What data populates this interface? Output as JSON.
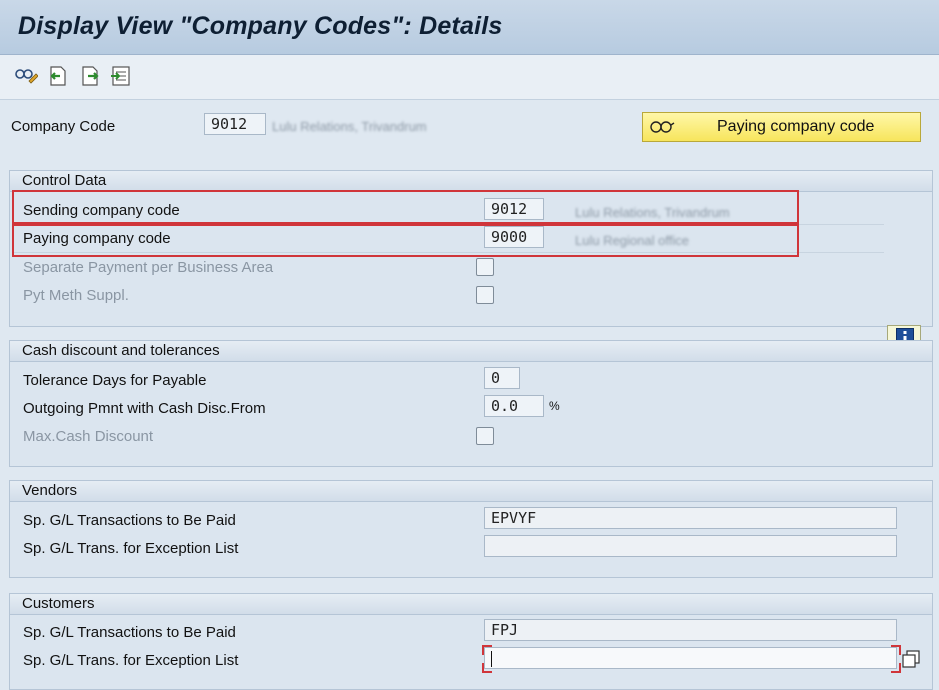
{
  "window": {
    "title": "Display View \"Company Codes\": Details"
  },
  "toolbar": {
    "icons": [
      "glasses-edit-icon",
      "previous-entry-icon",
      "next-entry-icon",
      "select-block-icon"
    ]
  },
  "company": {
    "label": "Company Code",
    "value": "9012",
    "name_text": "Lulu Relations, Trivandrum"
  },
  "paying_button": {
    "label": "Paying company code"
  },
  "control_data": {
    "title": "Control Data",
    "sending": {
      "label": "Sending company code",
      "value": "9012",
      "name_text": "Lulu Relations, Trivandrum"
    },
    "paying": {
      "label": "Paying company code",
      "value": "9000",
      "name_text": "Lulu Regional office"
    },
    "separate_payment": {
      "label": "Separate Payment per Business Area",
      "checked": false
    },
    "pyt_meth": {
      "label": "Pyt Meth Suppl.",
      "checked": false
    }
  },
  "cash_discount": {
    "title": "Cash discount and tolerances",
    "tolerance": {
      "label": "Tolerance Days for Payable",
      "value": "0"
    },
    "outgoing": {
      "label": "Outgoing Pmnt with Cash Disc.From",
      "value": "0.0",
      "unit": "%"
    },
    "max_cash": {
      "label": "Max.Cash Discount",
      "checked": false
    }
  },
  "vendors": {
    "title": "Vendors",
    "sp_paid": {
      "label": "Sp. G/L Transactions to Be Paid",
      "value": "EPVYF"
    },
    "sp_exception": {
      "label": "Sp. G/L Trans. for Exception List",
      "value": ""
    }
  },
  "customers": {
    "title": "Customers",
    "sp_paid": {
      "label": "Sp. G/L Transactions to Be Paid",
      "value": "FPJ"
    },
    "sp_exception": {
      "label": "Sp. G/L Trans. for Exception List",
      "value": ""
    }
  },
  "colors": {
    "highlight": "#d0353a",
    "button_yellow": "#f7e55c",
    "background": "#dfe8f1"
  }
}
